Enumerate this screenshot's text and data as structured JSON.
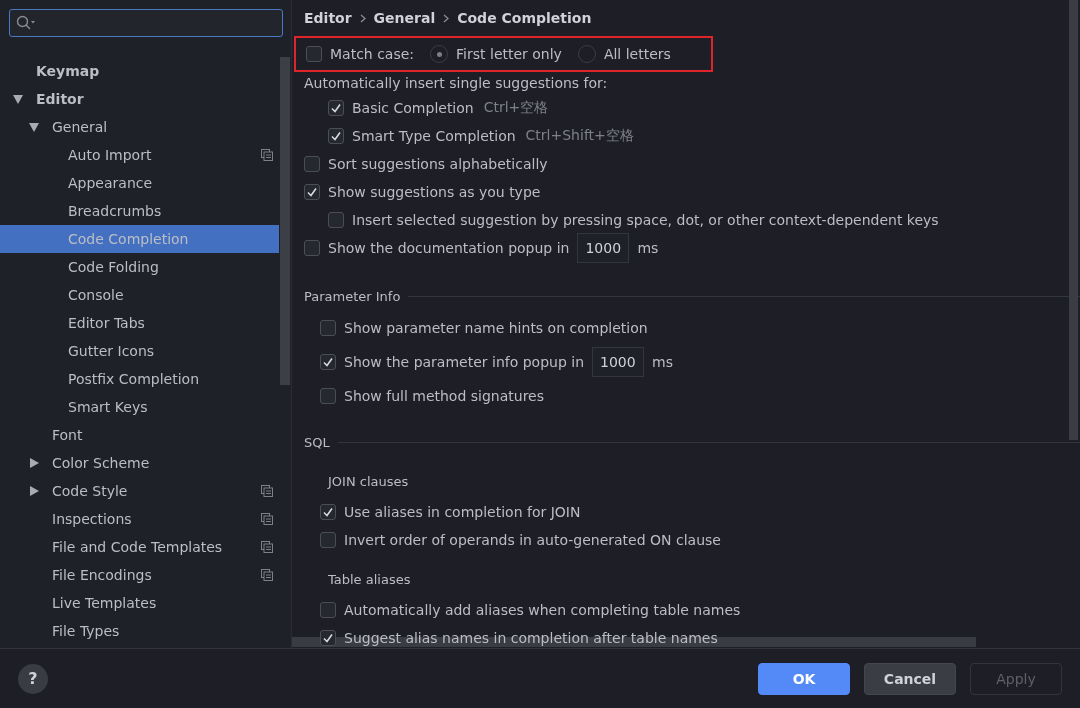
{
  "tree": [
    {
      "label": "Keymap"
    },
    {
      "label": "Editor",
      "expanded": true,
      "children": [
        {
          "label": "General",
          "expanded": true,
          "children": [
            {
              "label": "Auto Import",
              "shared": true
            },
            {
              "label": "Appearance"
            },
            {
              "label": "Breadcrumbs"
            },
            {
              "label": "Code Completion",
              "selected": true
            },
            {
              "label": "Code Folding"
            },
            {
              "label": "Console"
            },
            {
              "label": "Editor Tabs"
            },
            {
              "label": "Gutter Icons"
            },
            {
              "label": "Postfix Completion"
            },
            {
              "label": "Smart Keys"
            }
          ]
        },
        {
          "label": "Font"
        },
        {
          "label": "Color Scheme",
          "expanded": false
        },
        {
          "label": "Code Style",
          "expanded": false,
          "shared": true
        },
        {
          "label": "Inspections",
          "shared": true
        },
        {
          "label": "File and Code Templates",
          "shared": true
        },
        {
          "label": "File Encodings",
          "shared": true
        },
        {
          "label": "Live Templates"
        },
        {
          "label": "File Types"
        }
      ]
    }
  ],
  "breadcrumb": [
    "Editor",
    "General",
    "Code Completion"
  ],
  "match_case": {
    "label": "Match case:",
    "checked": false,
    "highlighted": true,
    "options": [
      {
        "label": "First letter only",
        "selected": true
      },
      {
        "label": "All letters",
        "selected": false
      }
    ]
  },
  "auto_insert": {
    "label": "Automatically insert single suggestions for:",
    "items": [
      {
        "label": "Basic Completion",
        "shortcut": "Ctrl+空格",
        "checked": true
      },
      {
        "label": "Smart Type Completion",
        "shortcut": "Ctrl+Shift+空格",
        "checked": true
      }
    ]
  },
  "options": [
    {
      "kind": "checkbox",
      "label": "Sort suggestions alphabetically",
      "checked": false
    },
    {
      "kind": "checkbox",
      "label": "Show suggestions as you type",
      "checked": true,
      "children": [
        {
          "kind": "checkbox",
          "label": "Insert selected suggestion by pressing space, dot, or other context-dependent keys",
          "checked": false
        }
      ]
    },
    {
      "kind": "field",
      "label": "Show the documentation popup in",
      "checked": false,
      "value": "1000",
      "unit": "ms"
    }
  ],
  "parameter_info": {
    "title": "Parameter Info",
    "rows": [
      {
        "kind": "checkbox",
        "label": "Show parameter name hints on completion",
        "checked": false
      },
      {
        "kind": "field",
        "label": "Show the parameter info popup in",
        "checked": true,
        "value": "1000",
        "unit": "ms"
      },
      {
        "kind": "checkbox",
        "label": "Show full method signatures",
        "checked": false
      }
    ]
  },
  "sql": {
    "title": "SQL",
    "groups": [
      {
        "title": "JOIN clauses",
        "rows": [
          {
            "kind": "checkbox",
            "label": "Use aliases in completion for JOIN",
            "checked": true
          },
          {
            "kind": "checkbox",
            "label": "Invert order of operands in auto-generated ON clause",
            "checked": false
          }
        ]
      },
      {
        "title": "Table aliases",
        "rows": [
          {
            "kind": "checkbox",
            "label": "Automatically add aliases when completing table names",
            "checked": false
          },
          {
            "kind": "checkbox",
            "label": "Suggest alias names in completion after table names",
            "checked": true
          }
        ]
      }
    ]
  },
  "help": "?",
  "buttons": [
    {
      "label": "OK",
      "kind": "primary",
      "disabled": false
    },
    {
      "label": "Cancel",
      "kind": "default",
      "disabled": false
    },
    {
      "label": "Apply",
      "kind": "default",
      "disabled": true
    }
  ]
}
